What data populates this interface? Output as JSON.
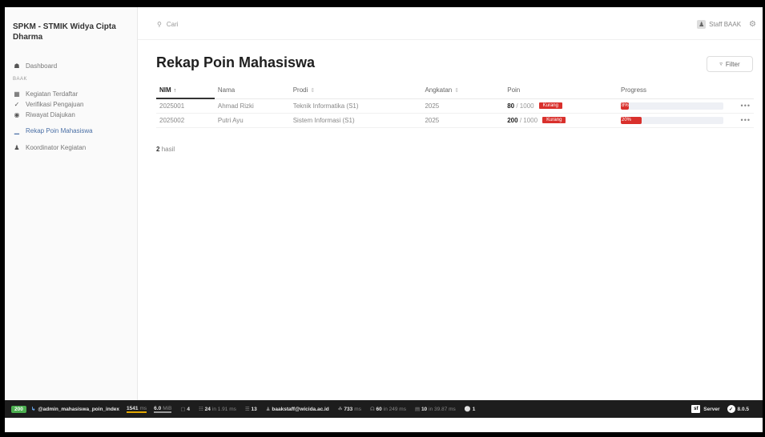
{
  "app": {
    "brand": "SPKM - STMIK Widya Cipta Dharma"
  },
  "sidebar": {
    "dashboard": "Dashboard",
    "section": "BAAK",
    "items": [
      {
        "label": "Kegiatan Terdaftar",
        "icon": "calendar-icon"
      },
      {
        "label": "Verifikasi Pengajuan",
        "icon": "check-icon"
      },
      {
        "label": "Riwayat Diajukan",
        "icon": "history-icon"
      },
      {
        "label": "Rekap Poin Mahasiswa",
        "icon": "chart-icon"
      },
      {
        "label": "Koordinator Kegiatan",
        "icon": "user-icon"
      }
    ]
  },
  "header": {
    "search_placeholder": "Cari",
    "user_name": "Staff BAAK"
  },
  "main": {
    "title": "Rekap Poin Mahasiswa",
    "filter_label": "Filter",
    "columns": {
      "nim": "NIM",
      "nama": "Nama",
      "prodi": "Prodi",
      "angkatan": "Angkatan",
      "poin": "Poin",
      "progress": "Progress"
    },
    "rows": [
      {
        "nim": "2025001",
        "nama": "Ahmad Rizki",
        "prodi": "Teknik Informatika (S1)",
        "angkatan": "2025",
        "poin": "80",
        "poin_max": " / 1000",
        "status": "Kurang",
        "progress_label": "8%",
        "progress": 0.08,
        "more": "•••"
      },
      {
        "nim": "2025002",
        "nama": "Putri Ayu",
        "prodi": "Sistem Informasi (S1)",
        "angkatan": "2025",
        "poin": "200",
        "poin_max": " / 1000",
        "status": "Kurang",
        "progress_label": "20%",
        "progress": 0.2,
        "more": "•••"
      }
    ],
    "count": "2",
    "count_suffix": "hasil"
  },
  "debugbar": {
    "status": "200",
    "route": "@admin_mahasiswa_poin_index",
    "time": "1541",
    "time_unit": "ms",
    "memory": "6.0",
    "memory_unit": "MiB",
    "forms": "4",
    "cache": "24",
    "cache_detail": "in 1.91 ms",
    "translations": "13",
    "user": "baakstaff@wicida.ac.id",
    "twig": "733",
    "twig_unit": "ms",
    "events": "60",
    "events_detail": "in 249 ms",
    "db": "10",
    "db_detail": "in 39.87 ms",
    "security": "1",
    "server": "Server",
    "version": "8.0.5"
  },
  "colors": {
    "accent": "#4a6fa5",
    "danger": "#d9302c",
    "debug_bg": "#1d1d1d"
  }
}
